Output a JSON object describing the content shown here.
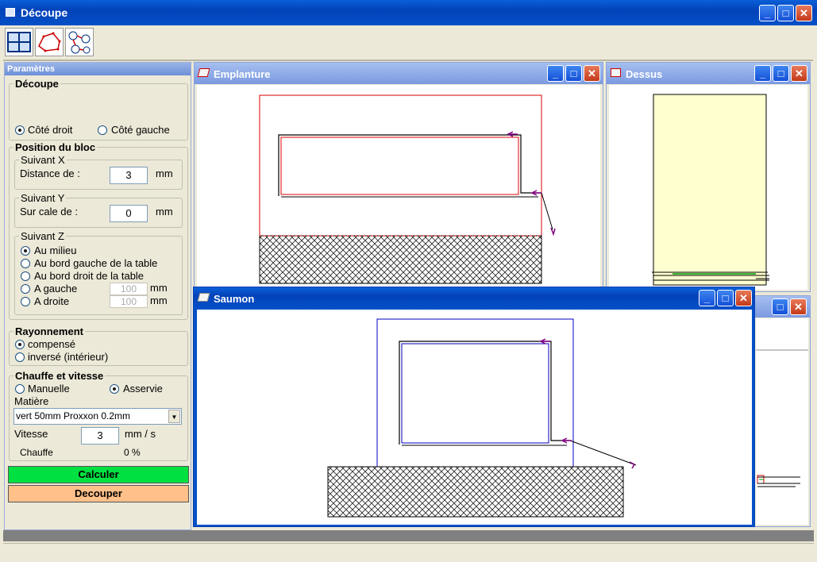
{
  "window": {
    "title": "Découpe"
  },
  "toolbar": {
    "icons": [
      "grid-layout-icon",
      "profile-shape-icon",
      "numbered-path-icon"
    ]
  },
  "params": {
    "header": "Paramètres",
    "decoupe": {
      "label": "Découpe",
      "side_right": "Côté droit",
      "side_left": "Côté gauche",
      "selected": "Côté droit"
    },
    "position": {
      "label": "Position du bloc",
      "x": {
        "label": "Suivant X",
        "distance_label": "Distance de :",
        "value": "3",
        "unit": "mm"
      },
      "y": {
        "label": "Suivant Y",
        "cale_label": "Sur cale de :",
        "value": "0",
        "unit": "mm"
      },
      "z": {
        "label": "Suivant Z",
        "options": [
          "Au milieu",
          "Au bord gauche de la table",
          "Au bord droit de la table",
          "A gauche",
          "A droite"
        ],
        "selected": "Au milieu",
        "gauche_value": "100",
        "droite_value": "100",
        "unit": "mm"
      }
    },
    "rayonnement": {
      "label": "Rayonnement",
      "options": [
        "compensé",
        "inversé (intérieur)"
      ],
      "selected": "compensé"
    },
    "chauffe": {
      "label": "Chauffe et vitesse",
      "manuelle": "Manuelle",
      "asservie": "Asservie",
      "selected": "Asservie",
      "matiere_label": "Matière",
      "matiere_value": "vert 50mm Proxxon 0.2mm",
      "vitesse_label": "Vitesse",
      "vitesse_value": "3",
      "vitesse_unit": "mm / s",
      "chauffe_label": "Chauffe",
      "chauffe_value": "0 %"
    },
    "buttons": {
      "calculer": "Calculer",
      "decouper": "Decouper"
    },
    "colors": {
      "calculer": "#00e040",
      "decouper": "#ffc08a"
    }
  },
  "windows": {
    "emplanture": {
      "title": "Emplanture"
    },
    "dessus": {
      "title": "Dessus"
    },
    "saumon": {
      "title": "Saumon"
    }
  },
  "controls": {
    "minimize": "_",
    "maximize": "□",
    "close": "✕"
  }
}
